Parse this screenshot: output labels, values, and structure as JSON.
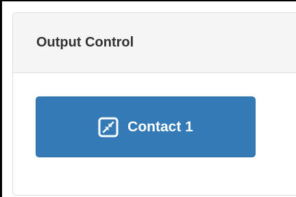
{
  "panel": {
    "title": "Output Control"
  },
  "contact_button": {
    "label": "Contact 1",
    "icon": "compress-icon"
  },
  "colors": {
    "button_background": "#337ab7",
    "panel_heading_background": "#f5f5f5",
    "panel_border": "#dddddd"
  }
}
